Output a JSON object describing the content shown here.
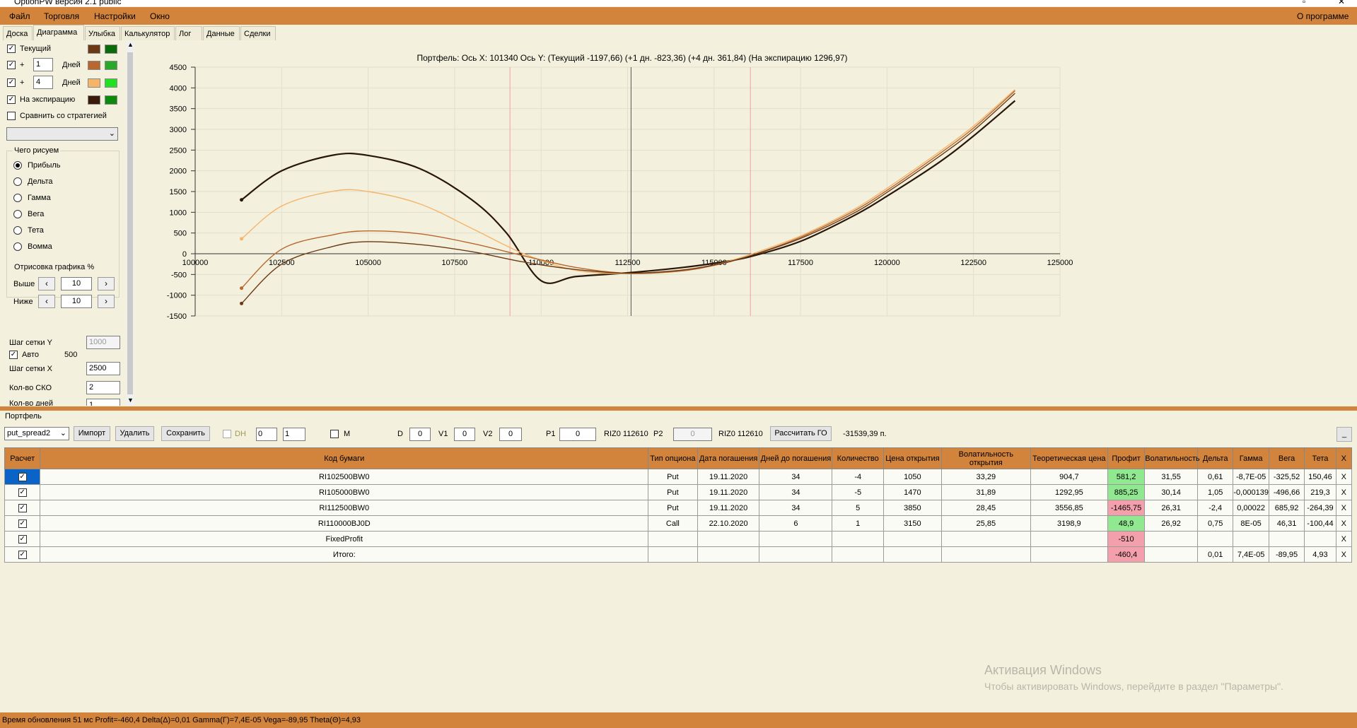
{
  "window": {
    "title": "OptionPW версия 2.1 public"
  },
  "menu": {
    "items": [
      "Файл",
      "Торговля",
      "Настройки",
      "Окно"
    ],
    "about": "О программе"
  },
  "tabs": [
    "Доска",
    "Диаграмма",
    "Улыбка",
    "Калькулятор",
    "Лог",
    "Данные",
    "Сделки"
  ],
  "left": {
    "current": "Текущий",
    "plus": "+",
    "days1_value": "1",
    "days2_value": "4",
    "days": "Дней",
    "expiry": "На экспирацию",
    "compare": "Сравнить со стратегией",
    "draw_group": "Чего рисуем",
    "radios": [
      "Прибыль",
      "Дельта",
      "Гамма",
      "Вега",
      "Тета",
      "Вомма"
    ],
    "render_group": "Отрисовка графика %",
    "above": "Выше",
    "below": "Ниже",
    "above_value": "10",
    "below_value": "10",
    "grid_y": "Шаг сетки Y",
    "grid_y_value": "1000",
    "auto": "Авто",
    "auto_value": "500",
    "grid_x": "Шаг сетки X",
    "grid_x_value": "2500",
    "sko": "Кол-во СКО",
    "sko_value": "2",
    "days_count": "Кол-во дней",
    "days_count_value": "1",
    "swatches": [
      [
        "#6b3a14",
        "#0b6b0b"
      ],
      [
        "#b8672e",
        "#2aa82a"
      ],
      [
        "#f5b46a",
        "#22e022"
      ],
      [
        "#3a1a08",
        "#0b8a0b"
      ]
    ]
  },
  "chart_data": {
    "type": "line",
    "title": "Портфель: Ось X: 101340 Ось Y:  (Текущий -1197,66)  (+1 дн. -823,36)  (+4 дн. 361,84)  (На экспирацию 1296,97)",
    "xlim": [
      100000,
      125000
    ],
    "ylim": [
      -1500,
      4500
    ],
    "x_ticks": [
      "100000",
      "102500",
      "105000",
      "107500",
      "110000",
      "112500",
      "115000",
      "117500",
      "120000",
      "122500",
      "125000"
    ],
    "y_ticks": [
      "4500",
      "4000",
      "3500",
      "3000",
      "2500",
      "2000",
      "1500",
      "1000",
      "500",
      "0",
      "-500",
      "-1000",
      "-1500"
    ],
    "vlines": [
      {
        "x": 109100,
        "color": "#f0a0a0"
      },
      {
        "x": 112600,
        "color": "#555555"
      },
      {
        "x": 116050,
        "color": "#f0a0a0"
      }
    ],
    "series": [
      {
        "color": "#2a1608",
        "width": 2.2,
        "x": [
          101340,
          102500,
          104000,
          105000,
          106500,
          108000,
          109000,
          110000,
          111000,
          112500,
          114000,
          115000,
          116000,
          117500,
          119000,
          120000,
          121500,
          122500,
          123700
        ],
        "y": [
          1300,
          2000,
          2380,
          2370,
          2050,
          1300,
          500,
          -650,
          -550,
          -460,
          -340,
          -230,
          -80,
          300,
          900,
          1390,
          2200,
          2840,
          3690
        ]
      },
      {
        "color": "#f5b46a",
        "width": 1.4,
        "x": [
          101340,
          102500,
          104000,
          105000,
          106500,
          108000,
          109500,
          111000,
          112500,
          114000,
          115000,
          116000,
          117500,
          119000,
          120000,
          121500,
          122500,
          123700
        ],
        "y": [
          360,
          1150,
          1510,
          1500,
          1200,
          610,
          0,
          -400,
          -480,
          -420,
          -270,
          -30,
          430,
          1050,
          1580,
          2450,
          3080,
          3960
        ]
      },
      {
        "color": "#b8672e",
        "width": 1.4,
        "x": [
          101340,
          102500,
          104000,
          105000,
          106500,
          108000,
          109500,
          111000,
          112500,
          114000,
          115000,
          116000,
          117500,
          119000,
          120000,
          121500,
          122500,
          123700
        ],
        "y": [
          -830,
          110,
          460,
          550,
          480,
          250,
          -50,
          -330,
          -470,
          -420,
          -280,
          -60,
          400,
          1010,
          1530,
          2400,
          3030,
          3930
        ]
      },
      {
        "color": "#6b3a14",
        "width": 1.4,
        "x": [
          101340,
          102500,
          104000,
          105000,
          106500,
          108000,
          109500,
          111000,
          112500,
          114000,
          115000,
          116000,
          117500,
          119000,
          120000,
          121500,
          122500,
          123700
        ],
        "y": [
          -1200,
          -250,
          180,
          290,
          220,
          50,
          -200,
          -380,
          -470,
          -400,
          -270,
          -60,
          370,
          960,
          1480,
          2340,
          2970,
          3870
        ]
      }
    ]
  },
  "portfolio": {
    "label": "Портфель",
    "name": "put_spread2",
    "import": "Импорт",
    "delete": "Удалить",
    "save": "Сохранить",
    "dh": "DH",
    "spin1": "0",
    "spin2": "1",
    "m": "M",
    "d_label": "D",
    "d_value": "0",
    "v1_label": "V1",
    "v1_value": "0",
    "v2_label": "V2",
    "v2_value": "0",
    "p1_label": "P1",
    "p1_value": "0",
    "riz1": "RIZ0 112610",
    "p2_label": "P2",
    "p2_value": "0",
    "riz2": "RIZ0 112610",
    "calc_go": "Рассчитать ГО",
    "go_value": "-31539,39 п.",
    "min_btn": "_"
  },
  "table": {
    "headers": [
      "Расчет",
      "Код бумаги",
      "Тип опциона",
      "Дата погашения",
      "Дней до погашения",
      "Количество",
      "Цена открытия",
      "Волатильность открытия",
      "Теоретическая цена",
      "Профит",
      "Волатильность",
      "Дельта",
      "Гамма",
      "Вега",
      "Тета",
      "X"
    ],
    "rows": [
      [
        "✓",
        "RI102500BW0",
        "Put",
        "19.11.2020",
        "34",
        "-4",
        "1050",
        "33,29",
        "904,7",
        "581,2",
        "31,55",
        "0,61",
        "-8,7E-05",
        "-325,52",
        "150,46",
        "X"
      ],
      [
        "✓",
        "RI105000BW0",
        "Put",
        "19.11.2020",
        "34",
        "-5",
        "1470",
        "31,89",
        "1292,95",
        "885,25",
        "30,14",
        "1,05",
        "-0,000139",
        "-496,66",
        "219,3",
        "X"
      ],
      [
        "✓",
        "RI112500BW0",
        "Put",
        "19.11.2020",
        "34",
        "5",
        "3850",
        "28,45",
        "3556,85",
        "-1465,75",
        "26,31",
        "-2,4",
        "0,00022",
        "685,92",
        "-264,39",
        "X"
      ],
      [
        "✓",
        "RI110000BJ0D",
        "Call",
        "22.10.2020",
        "6",
        "1",
        "3150",
        "25,85",
        "3198,9",
        "48,9",
        "26,92",
        "0,75",
        "8E-05",
        "46,31",
        "-100,44",
        "X"
      ],
      [
        "✓",
        "FixedProfit",
        "",
        "",
        "",
        "",
        "",
        "",
        "",
        "-510",
        "",
        "",
        "",
        "",
        "",
        "X"
      ],
      [
        "✓",
        "Итого:",
        "",
        "",
        "",
        "",
        "",
        "",
        "",
        "-460,4",
        "",
        "0,01",
        "7,4E-05",
        "-89,95",
        "4,93",
        "X"
      ]
    ],
    "profit_colors": [
      "green",
      "green",
      "pink",
      "green",
      "pink",
      "pink"
    ]
  },
  "watermark": {
    "line1": "Активация Windows",
    "line2": "Чтобы активировать Windows, перейдите в раздел \"Параметры\"."
  },
  "status": "Время обновления 51 мс  Profit=-460,4 Delta(Δ)=0,01 Gamma(Γ)=7,4E-05 Vega=-89,95 Theta(Θ)=4,93"
}
